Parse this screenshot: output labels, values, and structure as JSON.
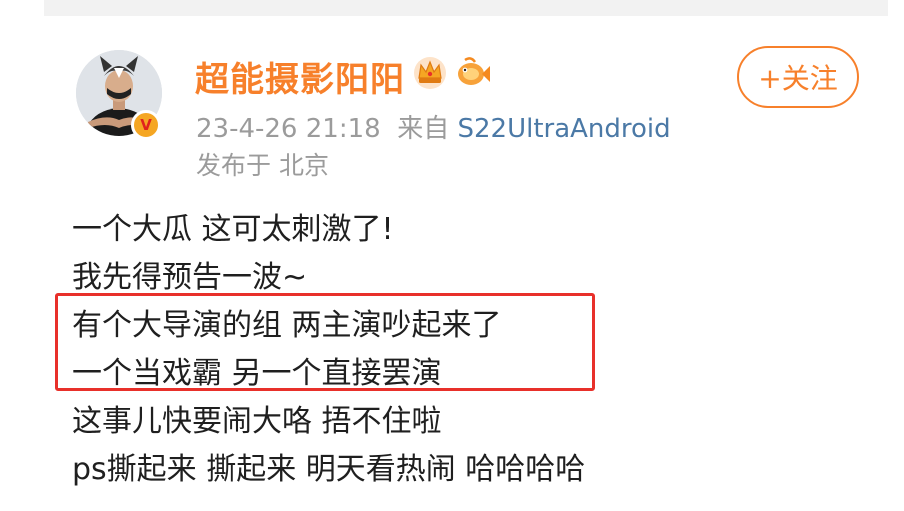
{
  "post": {
    "author": {
      "name": "超能摄影阳阳",
      "avatar_icon": "avatar-husky-icon",
      "verified_icon": "verified-v-badge-icon",
      "verified_mark": "V",
      "badges": [
        "crown-badge-icon",
        "fish-badge-icon"
      ]
    },
    "follow_label": "+关注",
    "timestamp": "23-4-26 21:18",
    "source_prefix": "来自",
    "source": "S22UltraAndroid",
    "location": "发布于 北京",
    "lines": [
      "一个大瓜  这可太刺激了!",
      "我先得预告一波~",
      "有个大导演的组 两主演吵起来了",
      "一个当戏霸 另一个直接罢演",
      "这事儿快要闹大咯 捂不住啦",
      "ps撕起来 撕起来 明天看热闹 哈哈哈哈"
    ],
    "highlighted_lines": [
      2,
      3
    ]
  },
  "colors": {
    "username": "#f7802b",
    "follow_button": "#f7802b",
    "meta_text": "#9b9b9b",
    "source_link": "#4b79a6",
    "body_text": "#1f1f1f",
    "highlight_box": "#e8302a",
    "verified_badge": "#f5a623"
  }
}
